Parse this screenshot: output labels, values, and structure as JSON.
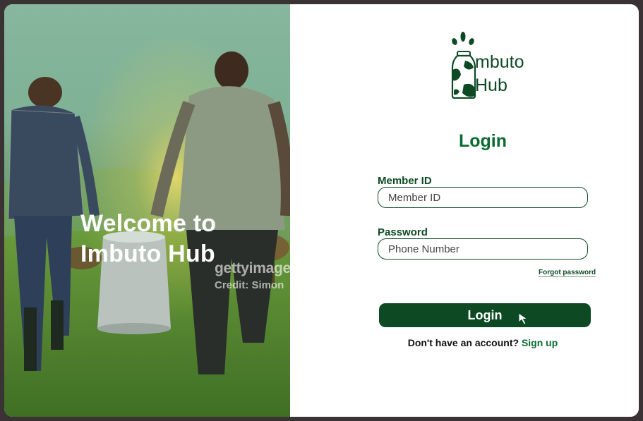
{
  "hero": {
    "title": "Welcome to\nImbuto Hub",
    "watermark_line1": "gettyimages",
    "watermark_line2": "Credit: Simon"
  },
  "logo": {
    "text": "mbuto\nHub",
    "icon": "milk-bottle-icon",
    "color": "#0d4a24"
  },
  "login": {
    "heading": "Login",
    "member_label": "Member ID",
    "member_placeholder": "Member ID",
    "password_label": "Password",
    "password_placeholder": "Phone Number",
    "forgot": "Forgot password",
    "button": "Login",
    "no_account": "Don't have an account?",
    "signup": "Sign up"
  },
  "colors": {
    "primary": "#0d4a24",
    "heading": "#0b6b31",
    "background": "#3a3234",
    "hero_overlay": "#7eb195"
  }
}
